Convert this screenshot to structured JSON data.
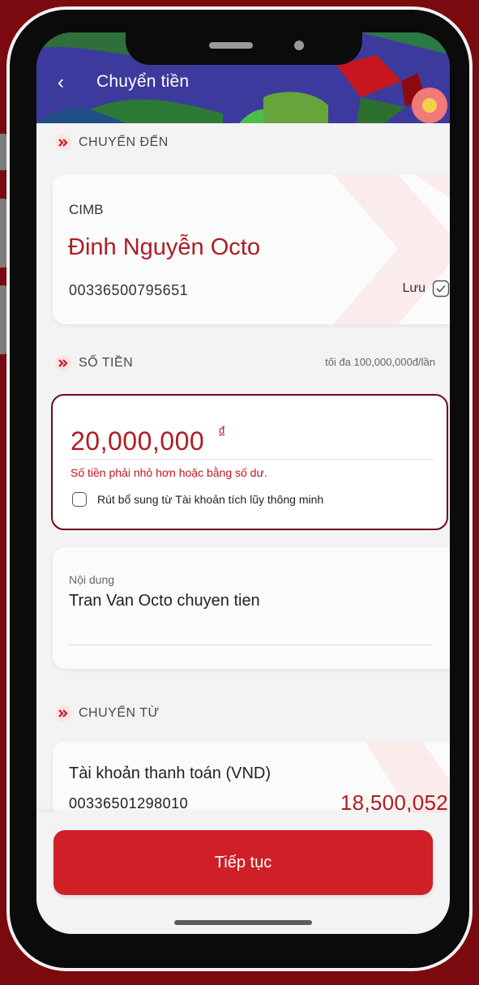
{
  "header": {
    "title": "Chuyển tiền",
    "back_icon": "‹"
  },
  "sections": {
    "to_label": "CHUYỂN ĐẾN",
    "amount_label": "SỐ TIỀN",
    "amount_limit": "tối đa 100,000,000đ/lần",
    "from_label": "CHUYỂN TỪ"
  },
  "recipient": {
    "bank": "CIMB",
    "name": "Đinh Nguyễn Octo",
    "account": "00336500795651",
    "save_label": "Lưu"
  },
  "amount": {
    "value": "20,000,000",
    "currency": "đ",
    "error": "Số tiền phải nhỏ hơn hoặc bằng số dư.",
    "topup_label": "Rút bổ sung từ Tài khoản tích lũy thông minh"
  },
  "note": {
    "label": "Nội dung",
    "value": "Tran Van Octo chuyen tien"
  },
  "source": {
    "name": "Tài khoản thanh toán (VND)",
    "account": "00336501298010",
    "balance": "18,500,052"
  },
  "actions": {
    "continue_label": "Tiếp tục"
  },
  "colors": {
    "brand": "#cf1f27",
    "background": "#7a0a0f",
    "header": "#3c3799"
  }
}
